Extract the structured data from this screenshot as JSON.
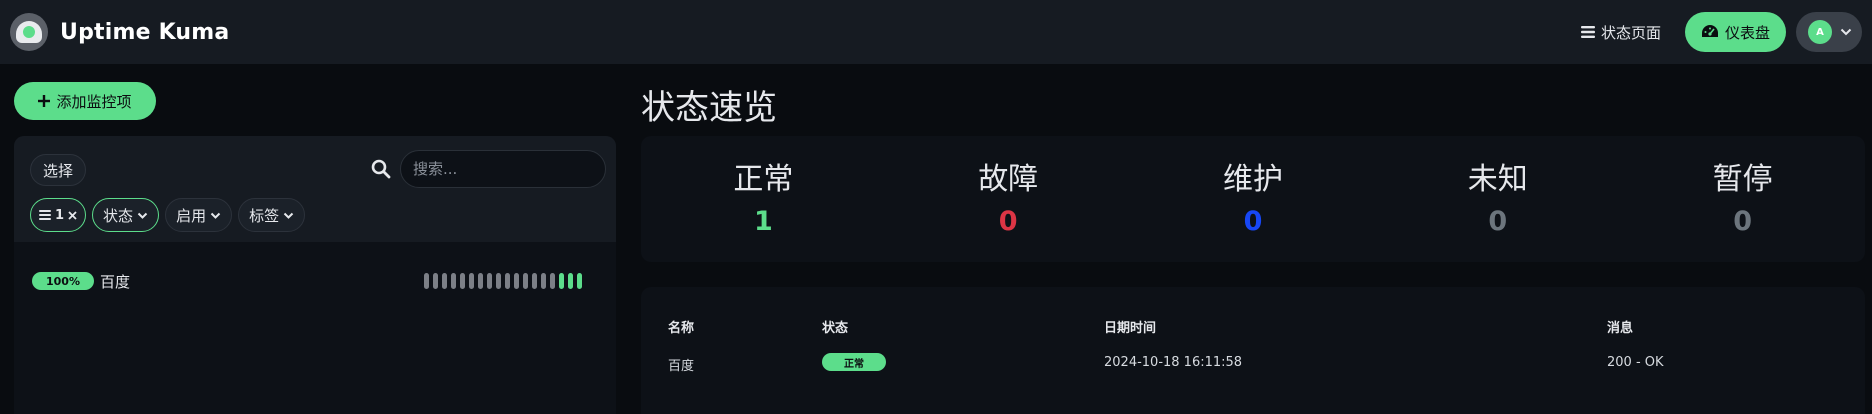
{
  "header": {
    "app_title": "Uptime Kuma",
    "status_page_label": "状态页面",
    "dashboard_label": "仪表盘",
    "avatar_initial": "A"
  },
  "sidebar": {
    "add_monitor_label": "添加监控项",
    "select_label": "选择",
    "search_placeholder": "搜索...",
    "filters": {
      "active_count_label": "1",
      "status_label": "状态",
      "active_label": "启用",
      "tags_label": "标签"
    },
    "monitors": [
      {
        "uptime": "100%",
        "name": "百度",
        "beats": [
          "gray",
          "gray",
          "gray",
          "gray",
          "gray",
          "gray",
          "gray",
          "gray",
          "gray",
          "gray",
          "gray",
          "gray",
          "gray",
          "gray",
          "gray",
          "up",
          "up",
          "up"
        ]
      }
    ]
  },
  "main": {
    "title": "状态速览",
    "stats": [
      {
        "label": "正常",
        "value": "1",
        "color": "#5cdd8b"
      },
      {
        "label": "故障",
        "value": "0",
        "color": "#dc3545"
      },
      {
        "label": "维护",
        "value": "0",
        "color": "#1747f5"
      },
      {
        "label": "未知",
        "value": "0",
        "color": "#6c757d"
      },
      {
        "label": "暂停",
        "value": "0",
        "color": "#6c757d"
      }
    ],
    "events": {
      "headers": {
        "name": "名称",
        "status": "状态",
        "datetime": "日期时间",
        "message": "消息"
      },
      "rows": [
        {
          "name": "百度",
          "status": "正常",
          "datetime": "2024-10-18 16:11:58",
          "message": "200 - OK"
        }
      ]
    }
  },
  "colors": {
    "accent": "#5cdd8b",
    "beat_gray": "#7c8087",
    "header_bg": "#161b22",
    "card_bg": "#0d1117",
    "page_bg": "#090c10"
  }
}
